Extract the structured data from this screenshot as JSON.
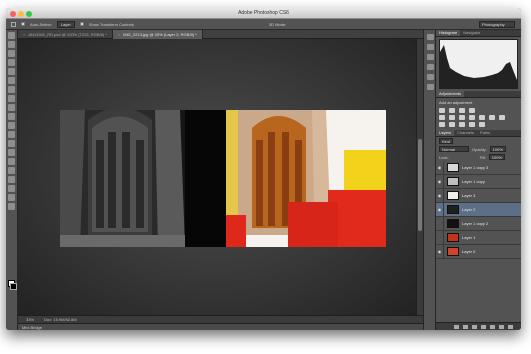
{
  "window": {
    "title": "Adobe Photoshop CS6"
  },
  "options": {
    "auto_select_label": "Auto-Select:",
    "auto_select_value": "Layer",
    "transform_label": "Show Transform Controls",
    "mode_3d_label": "3D Mode:",
    "workspace": "Photography"
  },
  "tabs": [
    {
      "label": "AN13302_RD.psd @ 100% (T225, RGB/8) *",
      "close": "×"
    },
    {
      "label": "IMG_2213.jpg @ 33% (Layer 2, RGB/8) *",
      "close": "×"
    }
  ],
  "status": {
    "zoom": "33%",
    "doc": "Doc: 15.9M/62.8M"
  },
  "mini_bridge": "Mini Bridge",
  "panels": {
    "top_tabs": [
      "Histogram",
      "Navigator"
    ],
    "adj_tabs": [
      "Adjustments"
    ],
    "adj_heading": "Add an adjustment",
    "layer_tabs": [
      "Layers",
      "Channels",
      "Paths"
    ],
    "kind": "Kind",
    "blend_mode": "Normal",
    "opacity_label": "Opacity:",
    "opacity_value": "100%",
    "lock_label": "Lock:",
    "fill_label": "Fill:",
    "fill_value": "100%",
    "eye_glyph": "◉"
  },
  "layers": [
    {
      "name": "Layer 1 copy 3",
      "visible": true,
      "selected": false,
      "thumb": "#d8d8d8"
    },
    {
      "name": "Layer 1 copy",
      "visible": true,
      "selected": false,
      "thumb": "#bfbfbf"
    },
    {
      "name": "Layer 3",
      "visible": true,
      "selected": false,
      "thumb": "#eeeeee"
    },
    {
      "name": "Layer 2",
      "visible": true,
      "selected": true,
      "thumb": "#202020"
    },
    {
      "name": "Layer 1 copy 2",
      "visible": false,
      "selected": false,
      "thumb": "#111111"
    },
    {
      "name": "Layer 1",
      "visible": false,
      "selected": false,
      "thumb": "#c3341c"
    },
    {
      "name": "Layer 0",
      "visible": true,
      "selected": false,
      "thumb": "#d0452a"
    }
  ],
  "colors": {
    "accent_selected": "#5d6f86",
    "panel_bg": "#535353",
    "app_bg": "#2c2c2c"
  },
  "tool_icons": [
    "move-icon",
    "marquee-icon",
    "lasso-icon",
    "quick-select-icon",
    "crop-icon",
    "eyedropper-icon",
    "healing-brush-icon",
    "brush-icon",
    "clone-stamp-icon",
    "history-brush-icon",
    "eraser-icon",
    "gradient-icon",
    "blur-icon",
    "dodge-icon",
    "pen-icon",
    "type-icon",
    "path-select-icon",
    "shape-icon",
    "hand-icon",
    "zoom-icon"
  ]
}
